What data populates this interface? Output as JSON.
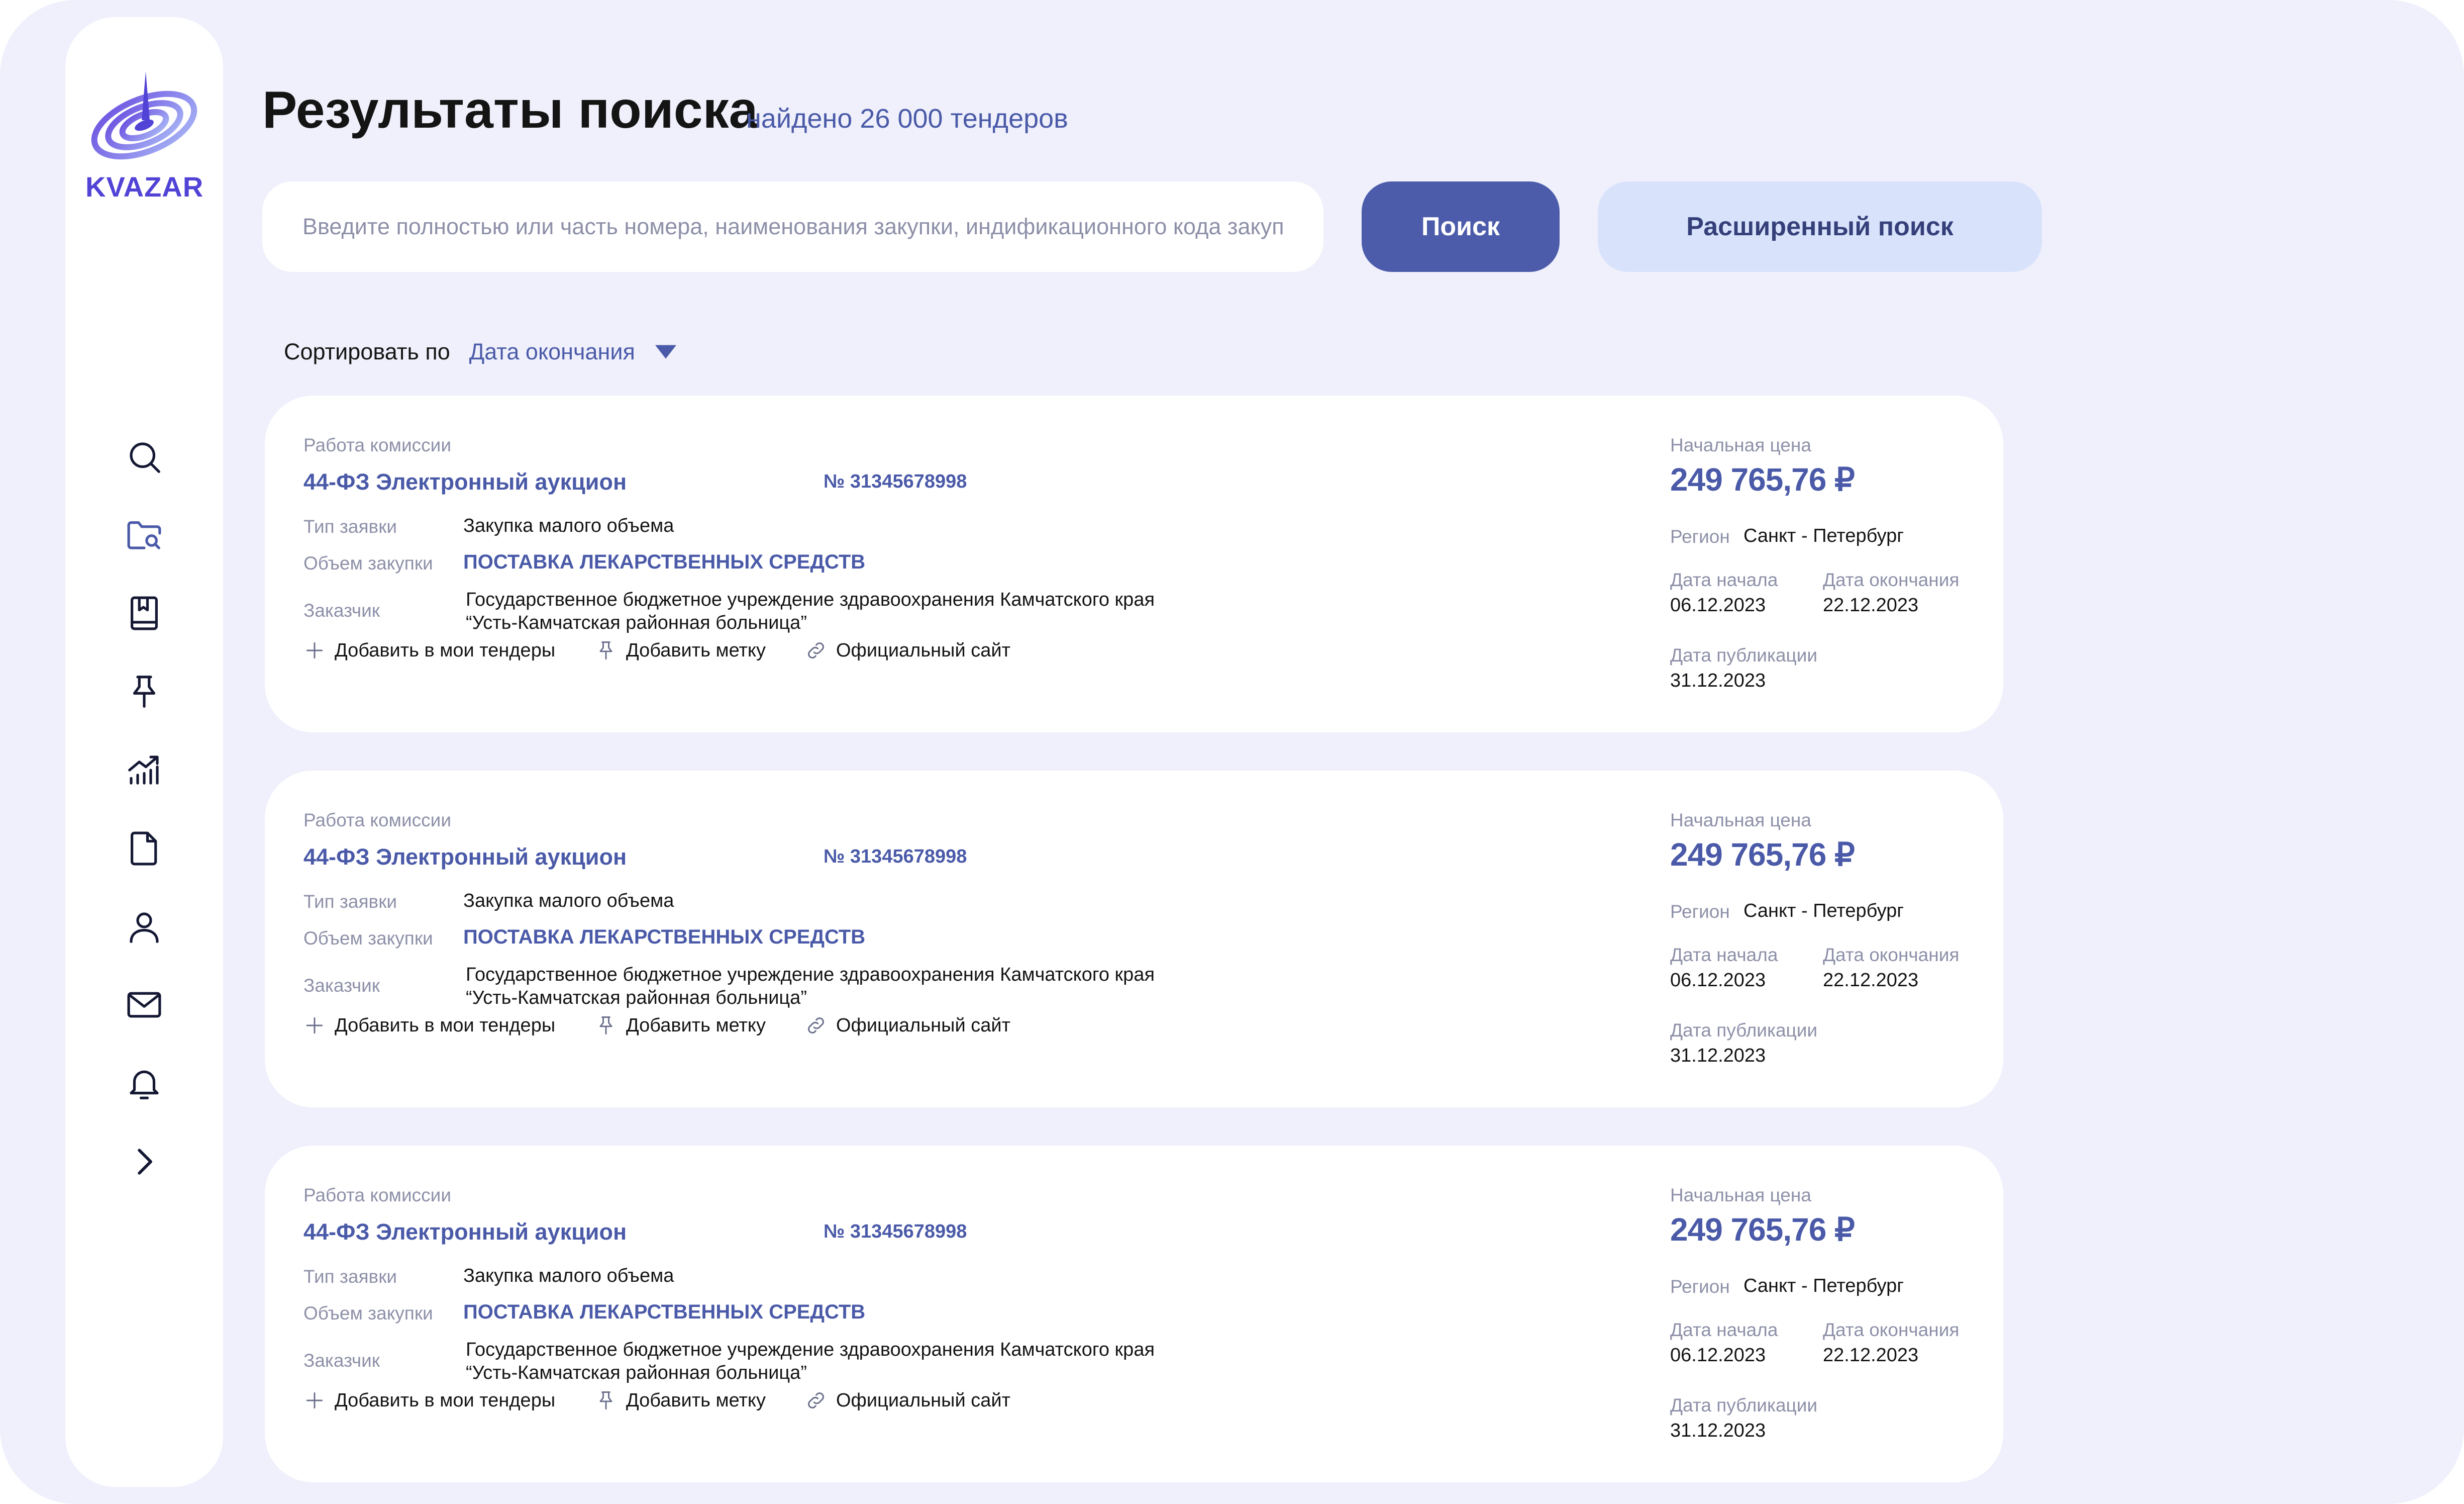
{
  "brand": {
    "name": "KVAZAR"
  },
  "colors": {
    "accent": "#4c5cab",
    "accent_light": "#d9e2fb",
    "logo": "#5143d6",
    "background": "#eff0fb"
  },
  "sidebar": {
    "items": [
      {
        "icon": "search-icon"
      },
      {
        "icon": "folder-search-icon"
      },
      {
        "icon": "bookmark-book-icon"
      },
      {
        "icon": "pin-icon"
      },
      {
        "icon": "analytics-icon"
      },
      {
        "icon": "document-icon"
      },
      {
        "icon": "user-icon"
      },
      {
        "icon": "mail-icon"
      },
      {
        "icon": "bell-icon"
      },
      {
        "icon": "chevron-right-icon"
      }
    ]
  },
  "header": {
    "title": "Результаты поиска",
    "found": "найдено 26 000 тендеров"
  },
  "search": {
    "placeholder": "Введите полностью или часть номера, наименования закупки, индификационного кода закупки",
    "submit_label": "Поиск",
    "advanced_label": "Расширенный поиск"
  },
  "sort": {
    "label": "Сортировать по",
    "selected": "Дата окончания"
  },
  "labels": {
    "stage": "Работа комиссии",
    "request_type": "Тип заявки",
    "volume": "Объем закупки",
    "customer": "Заказчик",
    "start_price": "Начальная цена",
    "region": "Регион",
    "start_date": "Дата начала",
    "end_date": "Дата окончания",
    "pub_date": "Дата публикации",
    "add_tender": "Добавить в мои тендеры",
    "add_tag": "Добавить метку",
    "official_site": "Официальный сайт"
  },
  "tenders": [
    {
      "procedure": "44-ФЗ Электронный аукцион",
      "number": "№ 31345678998",
      "request_type": "Закупка малого объема",
      "volume": "ПОСТАВКА ЛЕКАРСТВЕННЫХ СРЕДСТВ",
      "customer_line1": "Государственное бюджетное учреждение здравоохранения Камчатского края",
      "customer_line2": "“Усть-Камчатская районная больница”",
      "price": "249 765,76 ₽",
      "region": "Санкт - Петербург",
      "start_date": "06.12.2023",
      "end_date": "22.12.2023",
      "pub_date": "31.12.2023"
    },
    {
      "procedure": "44-ФЗ Электронный аукцион",
      "number": "№ 31345678998",
      "request_type": "Закупка малого объема",
      "volume": "ПОСТАВКА ЛЕКАРСТВЕННЫХ СРЕДСТВ",
      "customer_line1": "Государственное бюджетное учреждение здравоохранения Камчатского края",
      "customer_line2": "“Усть-Камчатская районная больница”",
      "price": "249 765,76 ₽",
      "region": "Санкт - Петербург",
      "start_date": "06.12.2023",
      "end_date": "22.12.2023",
      "pub_date": "31.12.2023"
    },
    {
      "procedure": "44-ФЗ Электронный аукцион",
      "number": "№ 31345678998",
      "request_type": "Закупка малого объема",
      "volume": "ПОСТАВКА ЛЕКАРСТВЕННЫХ СРЕДСТВ",
      "customer_line1": "Государственное бюджетное учреждение здравоохранения Камчатского края",
      "customer_line2": "“Усть-Камчатская районная больница”",
      "price": "249 765,76 ₽",
      "region": "Санкт - Петербург",
      "start_date": "06.12.2023",
      "end_date": "22.12.2023",
      "pub_date": "31.12.2023"
    }
  ]
}
